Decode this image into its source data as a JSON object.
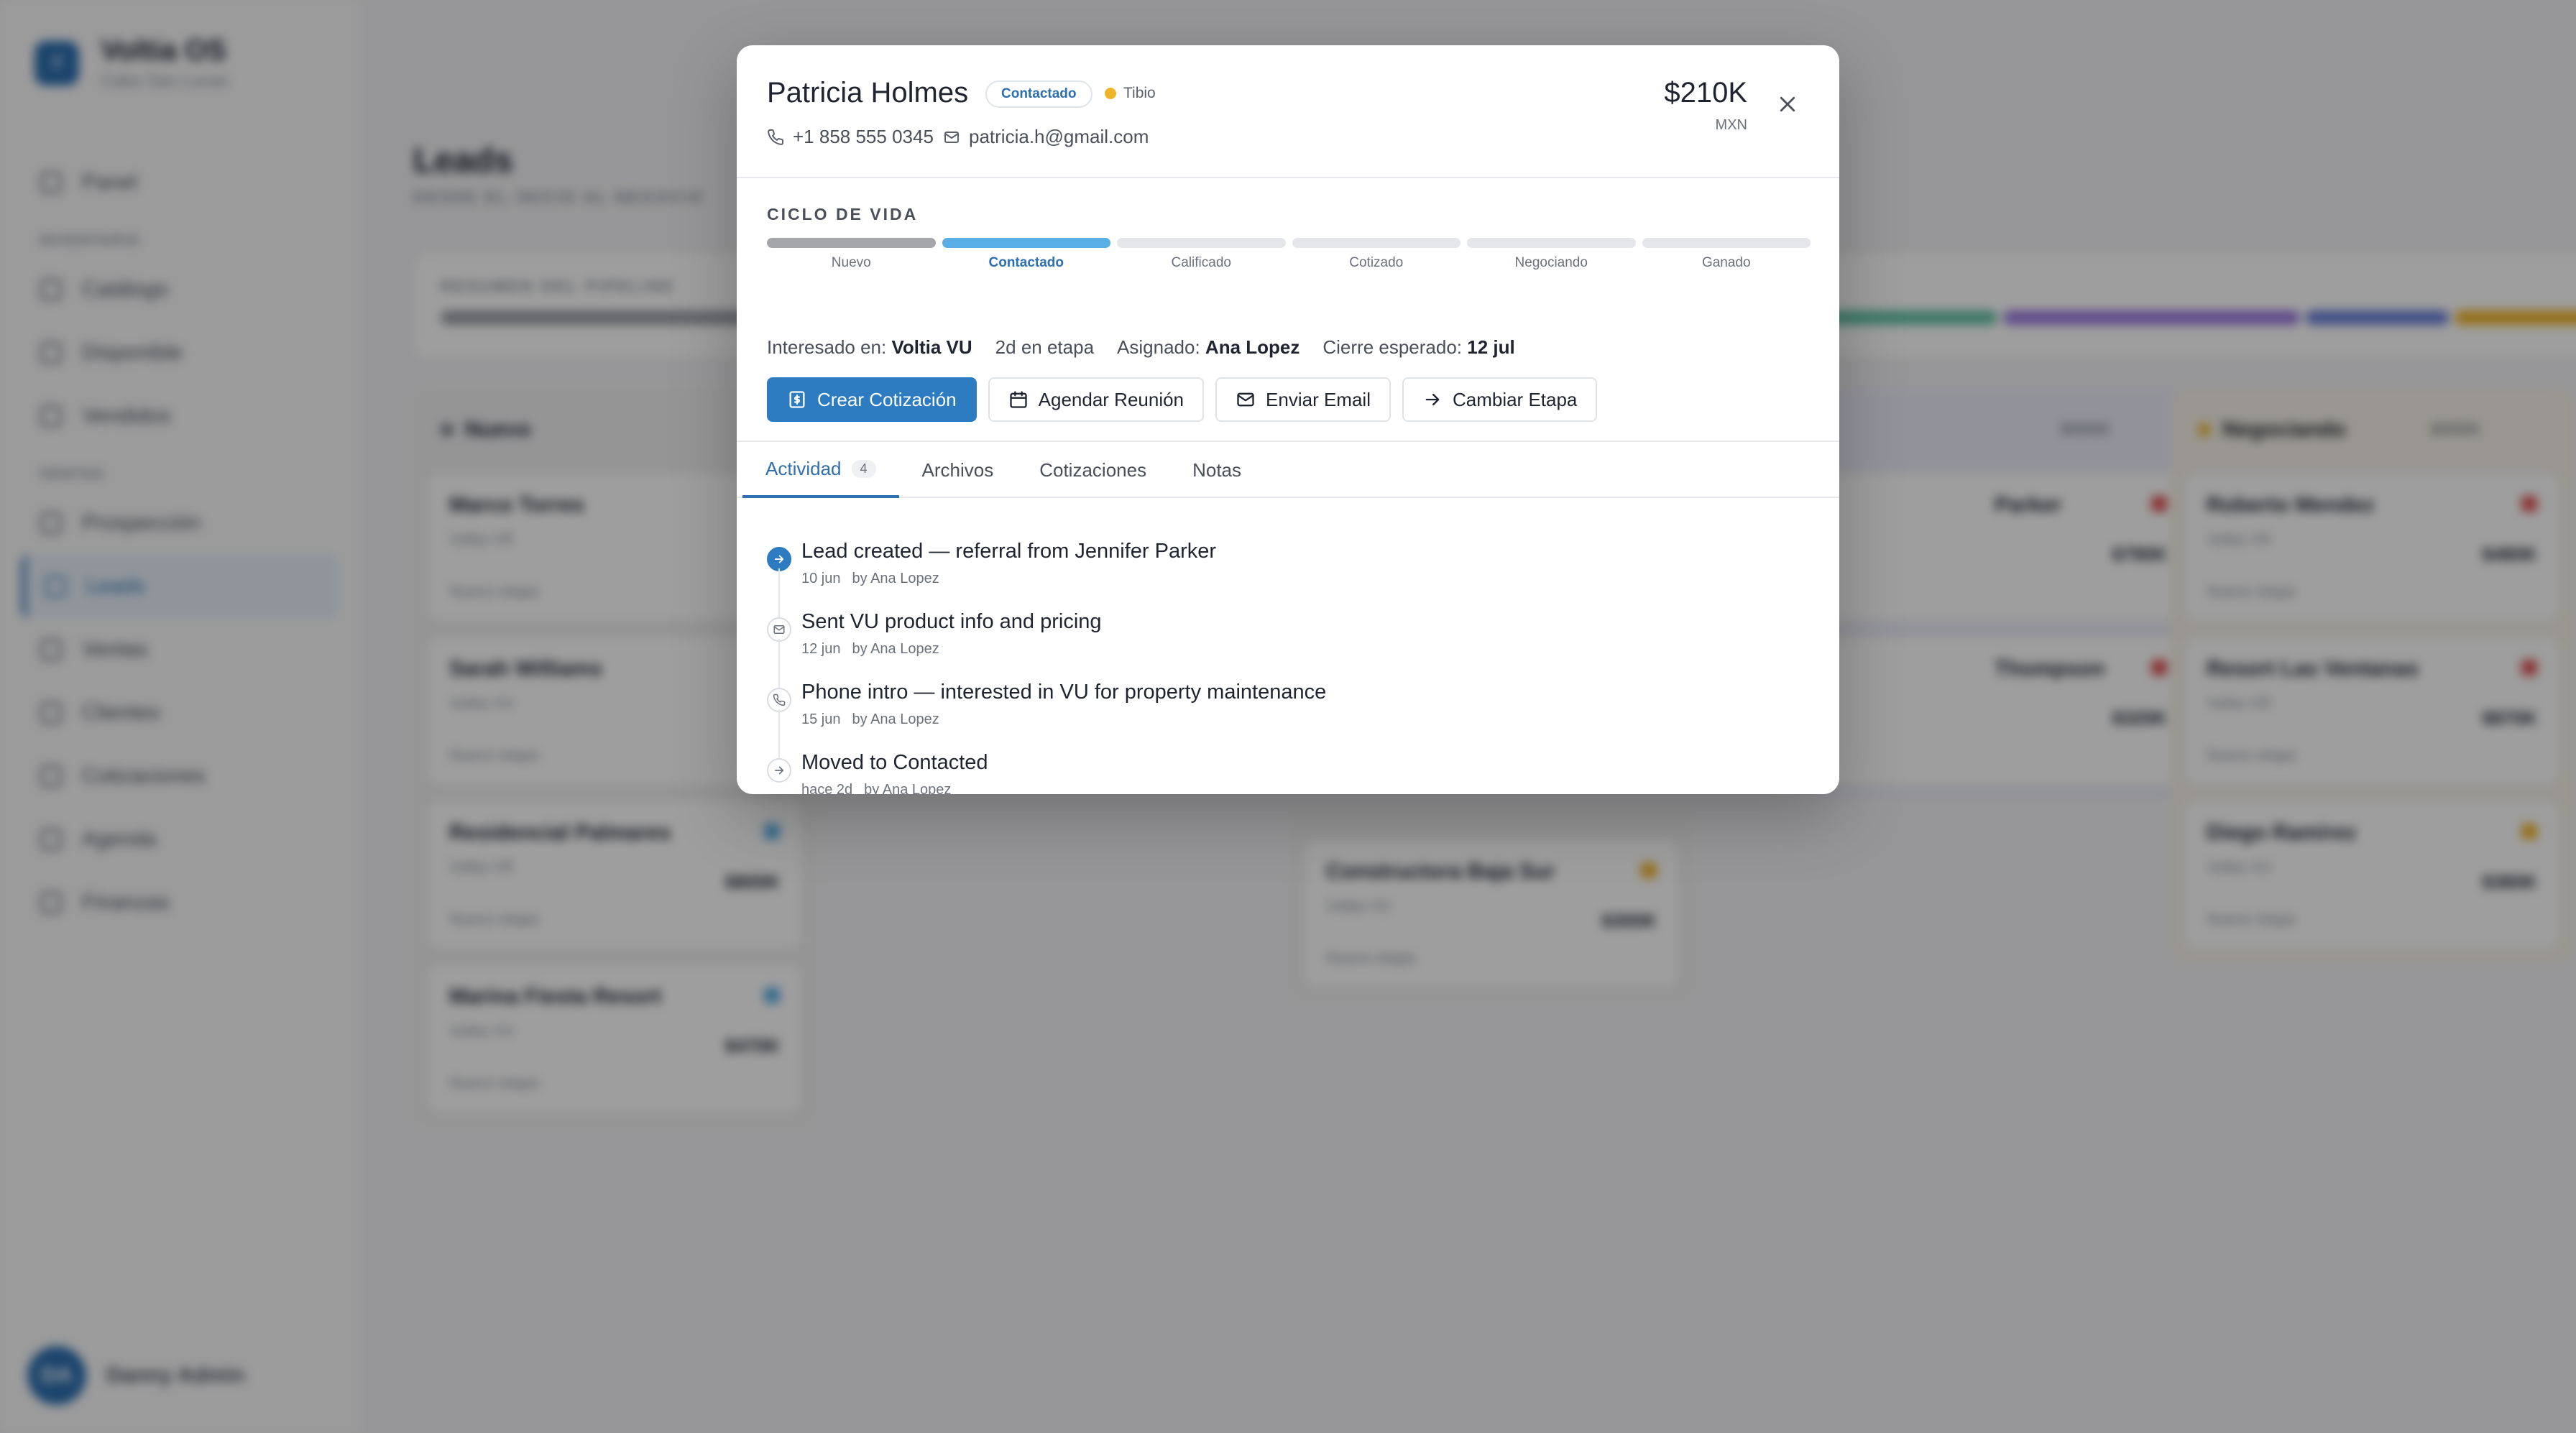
{
  "app": {
    "name": "Voltia OS",
    "subtitle": "Cabo San Lucas",
    "nav": {
      "item_panel": "Panel",
      "section_inventory": "INVENTARIO",
      "item_catalog": "Catálogo",
      "item_availability": "Disponible",
      "item_sold": "Vendidos",
      "section_sales": "VENTAS",
      "item_prospecting": "Prospección",
      "item_leads": "Leads",
      "item_ventas": "Ventas",
      "item_clients": "Clientes",
      "item_quotes": "Cotizaciones",
      "item_agenda": "Agenda",
      "item_finance": "Finanzas"
    },
    "user_initials": "DA",
    "user_name": "Danny Admin",
    "page_title": "Leads",
    "page_subtitle": "DESDE EL INICIO AL NEGOCIO",
    "pipeline_label": "RESUMEN DEL PIPELINE",
    "columns": {
      "c1": {
        "title": "Nuevo",
        "cards": {
          "a": {
            "name": "Marco Torres",
            "line": "Voltia VR",
            "foot": "Nuevo etapa"
          },
          "b": {
            "name": "Sarah Williams",
            "line": "Voltia VU",
            "foot": "Nuevo etapa"
          },
          "c": {
            "name": "Residencial Palmares",
            "line": "Voltia VR",
            "val": "$800K",
            "foot": "Nuevo etapa"
          },
          "d": {
            "name": "Marina Fiesta Resort",
            "line": "Voltia VU",
            "val": "$470K",
            "foot": "Nuevo etapa"
          }
        }
      },
      "c3": {
        "cards": {
          "a": {
            "name": "Constructora Baja Sur",
            "line": "Voltia VU",
            "val": "$300K",
            "foot": "Nuevo etapa"
          }
        }
      },
      "c4": {
        "amount": "$000K",
        "cards": {
          "a": {
            "name": "Parker",
            "val": "$790K"
          },
          "b": {
            "name": "Thompson",
            "val": "$320K"
          }
        }
      },
      "c5": {
        "title": "Negociando",
        "amount": "$000K",
        "cards": {
          "a": {
            "name": "Roberto Mendez",
            "line": "Voltia VR",
            "val": "$480K",
            "foot": "Nuevo etapa"
          },
          "b": {
            "name": "Resort Las Ventanas",
            "line": "Voltia VR",
            "val": "$870K",
            "foot": "Nuevo etapa"
          },
          "c": {
            "name": "Diego Ramirez",
            "line": "Voltia VU",
            "val": "$380K",
            "foot": "Nuevo etapa"
          }
        }
      }
    }
  },
  "modal": {
    "name": "Patricia Holmes",
    "stage_badge": "Contactado",
    "temperature": "Tibio",
    "phone": "+1 858 555 0345",
    "email": "patricia.h@gmail.com",
    "amount": "$210K",
    "currency": "MXN",
    "lifecycle_title": "CICLO DE VIDA",
    "stages": {
      "nuevo": "Nuevo",
      "contactado": "Contactado",
      "calificado": "Calificado",
      "cotizado": "Cotizado",
      "negociando": "Negociando",
      "ganado": "Ganado"
    },
    "meta": {
      "interested_label": "Interesado en:",
      "interested_value": "Voltia VU",
      "days_in_stage": "2d en etapa",
      "assigned_label": "Asignado:",
      "assigned_value": "Ana Lopez",
      "close_label": "Cierre esperado:",
      "close_value": "12 jul"
    },
    "actions": {
      "create_quote": "Crear Cotización",
      "schedule_meeting": "Agendar Reunión",
      "send_email": "Enviar Email",
      "change_stage": "Cambiar Etapa"
    },
    "tabs": {
      "activity": "Actividad",
      "activity_count": "4",
      "files": "Archivos",
      "quotes": "Cotizaciones",
      "notes": "Notas"
    },
    "timeline": {
      "e1": {
        "text": "Lead created — referral from Jennifer Parker",
        "date": "10 jun",
        "by": "by Ana Lopez"
      },
      "e2": {
        "text": "Sent VU product info and pricing",
        "date": "12 jun",
        "by": "by Ana Lopez"
      },
      "e3": {
        "text": "Phone intro — interested in VU for property maintenance",
        "date": "15 jun",
        "by": "by Ana Lopez"
      },
      "e4": {
        "text": "Moved to Contacted",
        "date": "hace 2d",
        "by": "by Ana Lopez"
      }
    }
  },
  "colors": {
    "accent": "#2d7bc0",
    "stage_current": "#5aaee6",
    "stage_done": "#a4a6ab",
    "warm": "#f0b429"
  }
}
